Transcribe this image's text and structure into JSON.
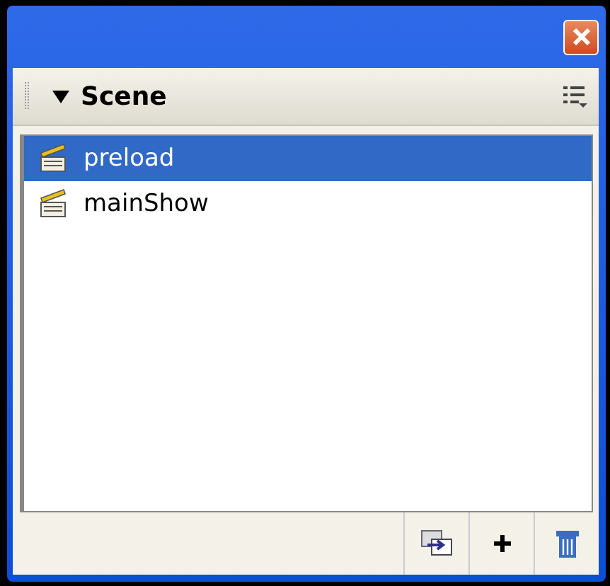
{
  "panel": {
    "title": "Scene",
    "expanded": true
  },
  "scenes": [
    {
      "name": "preload",
      "selected": true
    },
    {
      "name": "mainShow",
      "selected": false
    }
  ]
}
